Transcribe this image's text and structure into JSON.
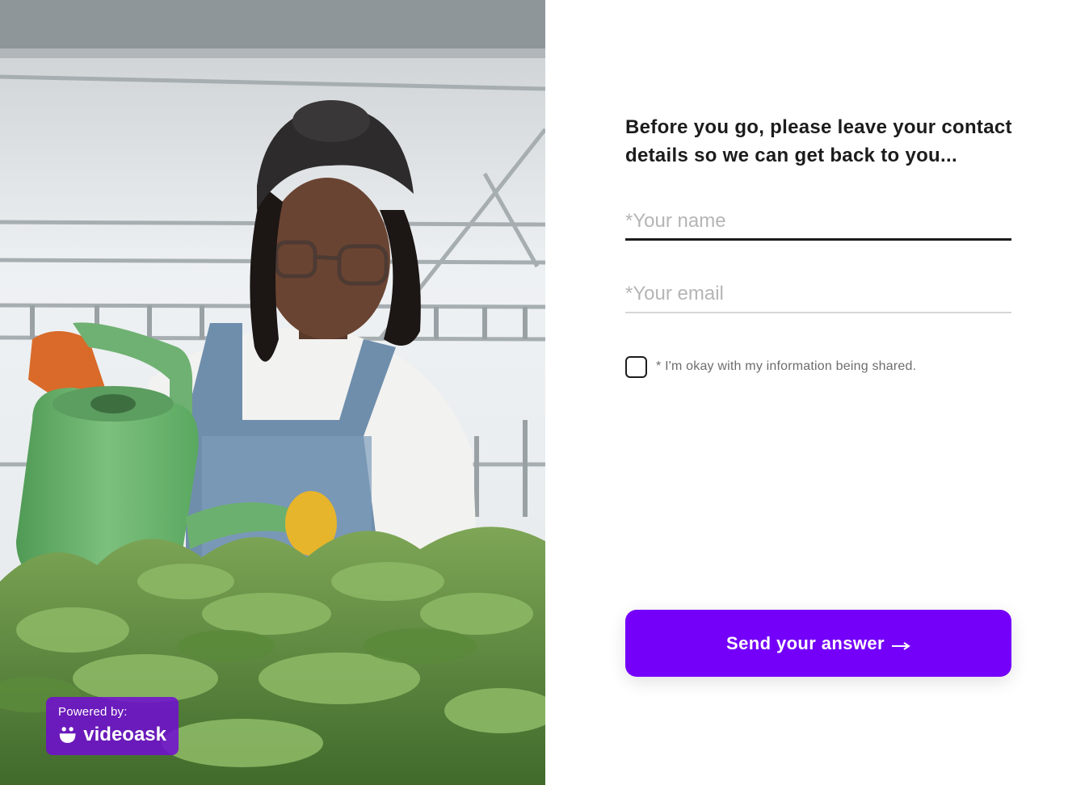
{
  "colors": {
    "accent": "#7400fa",
    "badge_background": "#700cd2",
    "text_primary": "#1c1c1c",
    "placeholder": "#b5b5b5",
    "consent_text": "#6d6d6d"
  },
  "video": {
    "icon": "video-frame-image",
    "badge": {
      "powered_by": "Powered by:",
      "brand": "videoask",
      "icon": "smiley-logo-icon"
    }
  },
  "form": {
    "heading": "Before you go, please leave your contact details so we can get back to you...",
    "name_placeholder": "*Your name",
    "name_value": "",
    "email_placeholder": "*Your email",
    "email_value": "",
    "consent_label": "* I'm okay with my information being shared.",
    "consent_checked": false,
    "submit_label": "Send your answer",
    "submit_icon": "arrow-right-icon"
  }
}
